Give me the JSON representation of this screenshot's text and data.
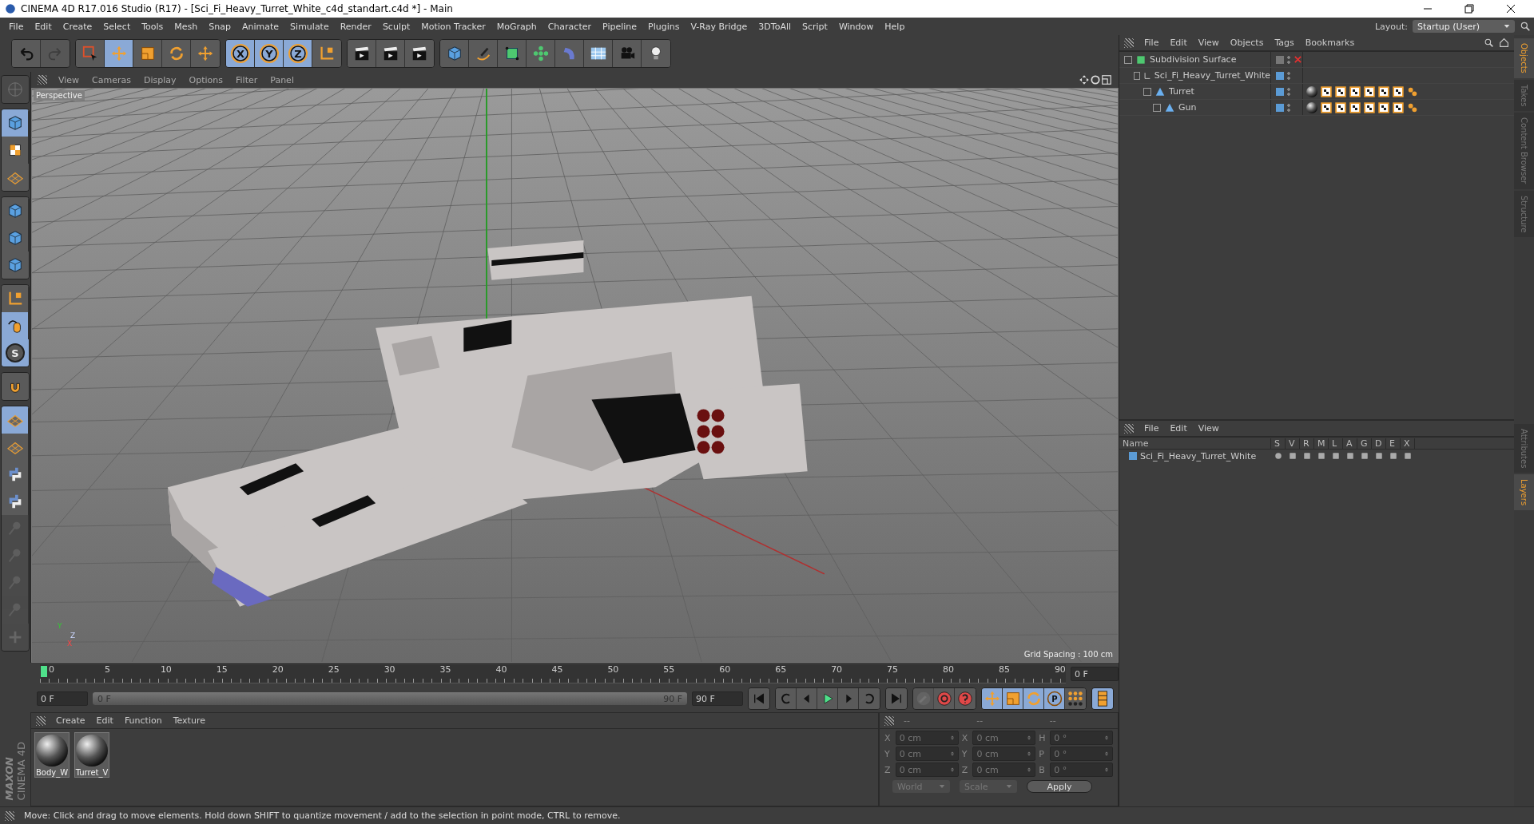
{
  "window": {
    "title": "CINEMA 4D R17.016 Studio (R17) - [Sci_Fi_Heavy_Turret_White_c4d_standart.c4d *] - Main"
  },
  "menu": [
    "File",
    "Edit",
    "Create",
    "Select",
    "Tools",
    "Mesh",
    "Snap",
    "Animate",
    "Simulate",
    "Render",
    "Sculpt",
    "Motion Tracker",
    "MoGraph",
    "Character",
    "Pipeline",
    "Plugins",
    "V-Ray Bridge",
    "3DToAll",
    "Script",
    "Window",
    "Help"
  ],
  "layout": {
    "label": "Layout:",
    "value": "Startup (User)"
  },
  "toolbar": [
    [
      {
        "kind": "undo",
        "selected": false,
        "disabled": false
      },
      {
        "kind": "redo",
        "selected": false,
        "disabled": true
      }
    ],
    [
      {
        "kind": "select",
        "selected": false,
        "disabled": false
      },
      {
        "kind": "move",
        "selected": true,
        "disabled": false
      },
      {
        "kind": "scale",
        "selected": false,
        "disabled": false
      },
      {
        "kind": "rotate",
        "selected": false,
        "disabled": false
      },
      {
        "kind": "move",
        "selected": false,
        "disabled": false
      }
    ],
    [
      {
        "kind": "axis",
        "label": "X",
        "selected": true,
        "disabled": false
      },
      {
        "kind": "axis",
        "label": "Y",
        "selected": true,
        "disabled": false
      },
      {
        "kind": "axis",
        "label": "Z",
        "selected": true,
        "disabled": false
      },
      {
        "kind": "coords",
        "selected": false,
        "disabled": false
      }
    ],
    [
      {
        "kind": "render",
        "selected": false,
        "disabled": false
      },
      {
        "kind": "render",
        "selected": false,
        "disabled": false
      },
      {
        "kind": "render",
        "selected": false,
        "disabled": false
      }
    ],
    [
      {
        "kind": "cube",
        "selected": false,
        "disabled": false
      },
      {
        "kind": "pen",
        "selected": false,
        "disabled": false
      },
      {
        "kind": "subdiv",
        "selected": false,
        "disabled": false
      },
      {
        "kind": "cloner",
        "selected": false,
        "disabled": false
      },
      {
        "kind": "deformer",
        "selected": false,
        "disabled": false
      },
      {
        "kind": "floor",
        "selected": false,
        "disabled": false
      },
      {
        "kind": "camera",
        "selected": false,
        "disabled": false
      },
      {
        "kind": "light",
        "selected": false,
        "disabled": false
      }
    ]
  ],
  "left_tools": [
    [
      {
        "kind": "globe",
        "selected": false,
        "disabled": true
      }
    ],
    [
      {
        "kind": "cube",
        "selected": true,
        "disabled": false
      },
      {
        "kind": "checker",
        "selected": false,
        "disabled": false
      },
      {
        "kind": "grid",
        "selected": false,
        "disabled": false
      }
    ],
    [
      {
        "kind": "cube",
        "selected": false,
        "disabled": false
      },
      {
        "kind": "cube",
        "selected": false,
        "disabled": false
      },
      {
        "kind": "cube",
        "selected": false,
        "disabled": false
      }
    ],
    [
      {
        "kind": "coords",
        "selected": false,
        "disabled": false
      },
      {
        "kind": "mouse",
        "selected": true,
        "disabled": false
      },
      {
        "kind": "snap",
        "label": "S",
        "selected": true,
        "disabled": false
      }
    ],
    [
      {
        "kind": "magnet",
        "selected": false,
        "disabled": false
      }
    ],
    [
      {
        "kind": "grid",
        "selected": true,
        "disabled": false
      },
      {
        "kind": "grid",
        "selected": false,
        "disabled": false
      },
      {
        "kind": "python",
        "selected": false,
        "disabled": false
      },
      {
        "kind": "python",
        "selected": false,
        "disabled": false
      },
      {
        "kind": "pin",
        "selected": false,
        "disabled": true
      },
      {
        "kind": "pin",
        "selected": false,
        "disabled": true
      },
      {
        "kind": "pin",
        "selected": false,
        "disabled": true
      },
      {
        "kind": "pin",
        "selected": false,
        "disabled": true
      },
      {
        "kind": "plus",
        "selected": false,
        "disabled": true
      }
    ]
  ],
  "viewport": {
    "menu": [
      "View",
      "Cameras",
      "Display",
      "Options",
      "Filter",
      "Panel"
    ],
    "camera": "Perspective",
    "grid_spacing": "Grid Spacing : 100 cm",
    "axis_labels": [
      "Y",
      "Z",
      "X"
    ]
  },
  "timeline": {
    "ticks": [
      "0",
      "5",
      "10",
      "15",
      "20",
      "25",
      "30",
      "35",
      "40",
      "45",
      "50",
      "55",
      "60",
      "65",
      "70",
      "75",
      "80",
      "85",
      "90"
    ],
    "current_frame": "0 F",
    "start": "0 F",
    "range_start": "0 F",
    "range_end": "90 F",
    "end": "90 F",
    "level": 1
  },
  "keyframe_tools": [
    {
      "kind": "motion",
      "selected": false,
      "disabled": true
    },
    {
      "kind": "record",
      "selected": false,
      "disabled": false
    },
    {
      "kind": "autokey",
      "selected": false,
      "disabled": false
    },
    {
      "kind": "move",
      "selected": true,
      "disabled": false
    },
    {
      "kind": "scale",
      "selected": true,
      "disabled": false
    },
    {
      "kind": "rotate",
      "selected": true,
      "disabled": false
    },
    {
      "kind": "param",
      "label": "P",
      "selected": true,
      "disabled": false
    },
    {
      "kind": "dots",
      "selected": false,
      "disabled": false
    },
    {
      "kind": "film",
      "selected": true,
      "disabled": false
    }
  ],
  "materials": {
    "menu": [
      "Create",
      "Edit",
      "Function",
      "Texture"
    ],
    "items": [
      {
        "name": "Body_W"
      },
      {
        "name": "Turret_V"
      }
    ],
    "logo": [
      "MAXON",
      "CINEMA 4D"
    ]
  },
  "coordinates": {
    "headers": [
      "--",
      "--",
      "--"
    ],
    "rows": [
      [
        {
          "label": "X",
          "value": "0 cm"
        },
        {
          "label": "X",
          "value": "0 cm"
        },
        {
          "label": "H",
          "value": "0 °"
        }
      ],
      [
        {
          "label": "Y",
          "value": "0 cm"
        },
        {
          "label": "Y",
          "value": "0 cm"
        },
        {
          "label": "P",
          "value": "0 °"
        }
      ],
      [
        {
          "label": "Z",
          "value": "0 cm"
        },
        {
          "label": "Z",
          "value": "0 cm"
        },
        {
          "label": "B",
          "value": "0 °"
        }
      ]
    ],
    "dropdowns": [
      "World",
      "Scale"
    ],
    "apply": "Apply"
  },
  "status_bar": "Move: Click and drag to move elements. Hold down SHIFT to quantize movement / add to the selection in point mode, CTRL to remove.",
  "objects": {
    "menu": [
      "File",
      "Edit",
      "View",
      "Objects",
      "Tags",
      "Bookmarks"
    ],
    "tree": [
      {
        "name": "Subdivision Surface",
        "kind": "subdiv",
        "layer": false,
        "enabled": false,
        "children": [
          {
            "name": "Sci_Fi_Heavy_Turret_White",
            "kind": "null",
            "layer": true,
            "children": [
              {
                "name": "Turret",
                "kind": "polygon",
                "layer": true,
                "tags": [
                  {
                    "kind": "material"
                  },
                  {
                    "kind": "checker"
                  },
                  {
                    "kind": "checker"
                  },
                  {
                    "kind": "checker"
                  },
                  {
                    "kind": "checker"
                  },
                  {
                    "kind": "checker"
                  },
                  {
                    "kind": "checker"
                  },
                  {
                    "kind": "phong"
                  }
                ],
                "children": [
                  {
                    "name": "Gun",
                    "kind": "polygon",
                    "layer": true,
                    "tags": [
                      {
                        "kind": "material"
                      },
                      {
                        "kind": "checker"
                      },
                      {
                        "kind": "checker"
                      },
                      {
                        "kind": "checker"
                      },
                      {
                        "kind": "checker"
                      },
                      {
                        "kind": "checker"
                      },
                      {
                        "kind": "checker"
                      },
                      {
                        "kind": "phong"
                      }
                    ]
                  }
                ]
              }
            ]
          }
        ]
      }
    ]
  },
  "layers": {
    "menu": [
      "File",
      "Edit",
      "View"
    ],
    "columns": [
      "Name",
      "S",
      "V",
      "R",
      "M",
      "L",
      "A",
      "G",
      "D",
      "E",
      "X"
    ],
    "items": [
      {
        "name": "Sci_Fi_Heavy_Turret_White",
        "color": "#5b9bd5"
      }
    ]
  },
  "side_tabs_top": [
    {
      "label": "Objects",
      "selected": true
    },
    {
      "label": "Takes",
      "selected": false
    },
    {
      "label": "Content Browser",
      "selected": false
    },
    {
      "label": "Structure",
      "selected": false
    }
  ],
  "side_tabs_bottom": [
    {
      "label": "Attributes",
      "selected": false
    },
    {
      "label": "Layers",
      "selected": true
    }
  ]
}
